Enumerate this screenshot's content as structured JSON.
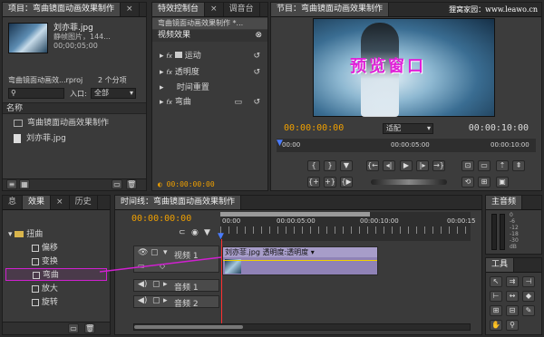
{
  "project": {
    "tabs": [
      "项目：弯曲镜面动画效果制作",
      "×"
    ],
    "clip_name": "刘亦菲.jpg",
    "clip_type": "静帧图片，144...",
    "clip_duration": "00;00;05;00",
    "project_file": "弯曲镜面动画效...rproj",
    "item_count": "2 个分项",
    "inport_label": "入口:",
    "inport_value": "全部",
    "name_header": "名称",
    "items": [
      "弯曲镜面动画效果制作",
      "刘亦菲.jpg"
    ]
  },
  "effect_controls": {
    "tabs": [
      "特效控制台",
      "×",
      "调音台"
    ],
    "header": "弯曲镜面动画效果制作 *...",
    "section": "视频效果",
    "rows": [
      "运动",
      "透明度",
      "时间重置",
      "弯曲"
    ],
    "timecode": "00:00:00:00"
  },
  "program": {
    "tab": "节目：弯曲镜面动画效果制作",
    "watermark": "狸窝家园：www.leawo.cn",
    "preview_label": "预览窗口",
    "timecode_left": "00:00:00:00",
    "fit": "适配",
    "timecode_right": "00:00:10:00",
    "ruler_labels": [
      "00:00",
      "00:00:05:00",
      "00:00:10:00"
    ]
  },
  "effects_panel": {
    "tabs": [
      "息",
      "效果",
      "×",
      "历史"
    ],
    "folder": "扭曲",
    "items": [
      "偏移",
      "变换",
      "弯曲",
      "放大",
      "旋转"
    ]
  },
  "timeline": {
    "tab": "时间线：弯曲镜面动画效果制作",
    "timecode": "00:00:00:00",
    "ruler_labels": [
      "00:00",
      "00:00:05:00",
      "00:00:10:00",
      "00:00:15"
    ],
    "video_track": "视频 1",
    "audio_tracks": [
      "音频 1",
      "音频 2"
    ],
    "clip_label": "刘亦菲.jpg 透明度:透明度 ▾"
  },
  "audio_master": {
    "tab": "主音频",
    "scale": [
      "0",
      "-6",
      "-12",
      "-18",
      "-30",
      "dB"
    ]
  },
  "tools": {
    "tab": "工具"
  },
  "colors": {
    "accent": "#f0a000",
    "highlight": "#d020d0",
    "clip": "#8f82b6"
  }
}
